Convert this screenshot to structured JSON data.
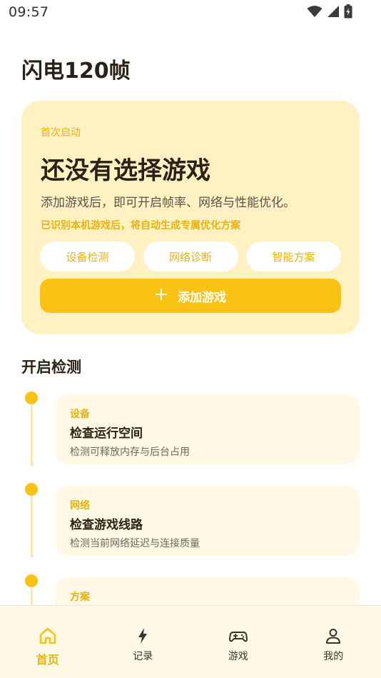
{
  "status_bar": {
    "time": "09:57",
    "icons": [
      "wifi-icon",
      "cellular-signal-icon",
      "battery-charging-icon"
    ]
  },
  "app": {
    "title": "闪电120帧"
  },
  "hero": {
    "eyebrow": "首次启动",
    "title": "还没有选择游戏",
    "description": "添加游戏后，即可开启帧率、网络与性能优化。",
    "note": "已识别本机游戏后，将自动生成专属优化方案",
    "chips": [
      {
        "label": "设备检测"
      },
      {
        "label": "网络诊断"
      },
      {
        "label": "智能方案"
      }
    ],
    "add_button": {
      "icon": "plus-icon",
      "label": "添加游戏"
    }
  },
  "detect_section": {
    "title": "开启检测",
    "items": [
      {
        "tag": "设备",
        "title": "检查运行空间",
        "desc": "检测可释放内存与后台占用"
      },
      {
        "tag": "网络",
        "title": "检查游戏线路",
        "desc": "检测当前网络延迟与连接质量"
      },
      {
        "tag": "方案",
        "title": "",
        "desc": ""
      }
    ]
  },
  "bottom_nav": {
    "items": [
      {
        "label": "首页",
        "icon": "home-icon",
        "active": true
      },
      {
        "label": "记录",
        "icon": "lightning-icon",
        "active": false
      },
      {
        "label": "游戏",
        "icon": "gamepad-icon",
        "active": false
      },
      {
        "label": "我的",
        "icon": "person-icon",
        "active": false
      }
    ]
  },
  "colors": {
    "accent": "#FAC212",
    "accent_text": "#E9B20C",
    "hero_bg": "#FFF1C2",
    "card_bg": "#FFF9E6",
    "text_primary": "#2A2217"
  }
}
